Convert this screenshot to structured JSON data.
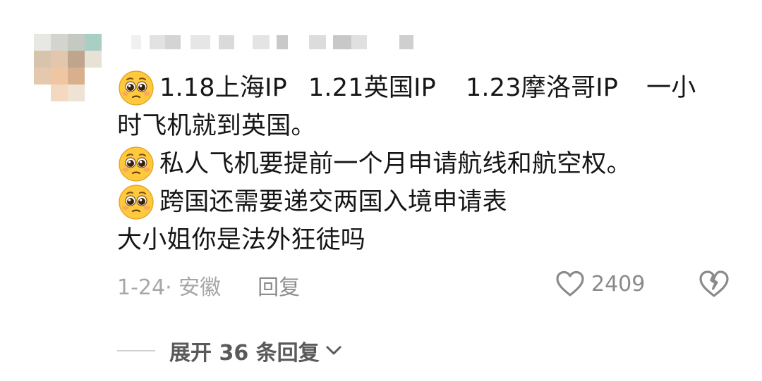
{
  "comment": {
    "lines": [
      {
        "has_emoji": true,
        "segments": [
          "1.18上海IP",
          "1.21英国IP",
          "1.23摩洛哥IP",
          "一小"
        ]
      },
      {
        "has_emoji": false,
        "segments": [
          "时飞机就到英国。"
        ]
      },
      {
        "has_emoji": true,
        "segments": [
          "私人飞机要提前一个月申请航线和航空权。"
        ]
      },
      {
        "has_emoji": true,
        "segments": [
          "跨国还需要递交两国入境申请表"
        ]
      },
      {
        "has_emoji": false,
        "segments": [
          "大小姐你是法外狂徒吗"
        ]
      }
    ],
    "emoji_name": "pleading-face-emoji"
  },
  "meta": {
    "date_location": "1-24· 安徽",
    "reply_label": "回复"
  },
  "actions": {
    "like_count": "2409",
    "like_icon": "heart-outline-icon",
    "dislike_icon": "broken-heart-icon"
  },
  "replies": {
    "expand_label": "展开 36 条回复",
    "expand_icon": "chevron-down-icon"
  },
  "colors": {
    "text": "#161616",
    "meta": "#a7a7a7",
    "icon": "#8a8a8a",
    "emoji_face": "#FFC83D",
    "emoji_blush": "#F59A6E"
  }
}
